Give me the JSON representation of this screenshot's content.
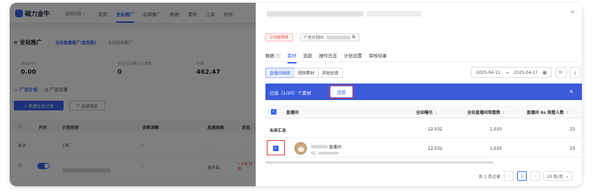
{
  "topnav": {
    "logo": "磁力金牛",
    "back": "返回旧版 ›",
    "items": [
      "首页",
      "全站推广",
      "品牌推广",
      "数据",
      "素材",
      "工具",
      "财务"
    ]
  },
  "campaign_panel": {
    "title": "全站推广",
    "tab_live": "全站直播推广(智投版)",
    "tab_goods": "全站商品推广",
    "metrics": [
      {
        "label": "全站ROI",
        "value": "0.00"
      },
      {
        "label": "全站当日累计订单数",
        "value": "0"
      },
      {
        "label": "花费",
        "value": "462.47"
      }
    ]
  },
  "plan_panel": {
    "tab_plan": "广告计划",
    "tab_creative": "广告创意",
    "new_button": "+ 新建全站计划",
    "filter_button": "全部筛选",
    "columns": [
      "开关",
      "计划名称",
      "诊断洞察",
      "加速探索",
      "状态"
    ],
    "total_row": {
      "label": "总计",
      "count": "1项",
      "dash1": "-",
      "dash2": "-",
      "dash3": "-"
    },
    "row": {
      "dash": "-",
      "status": "未开启",
      "note": "• 计划 原因"
    }
  },
  "drawer": {
    "close": "×",
    "tag_budget": "计划超预算",
    "tag_plan_id": "广告计划ID:",
    "tabs": [
      "数据",
      "素材",
      "追投",
      "操作日志",
      "计划设置",
      "审核结果"
    ],
    "active_tab": "素材",
    "segments": [
      "直播间画面",
      "视频素材",
      "其他创意"
    ],
    "date_start": "2025-04-11",
    "date_sep": "→",
    "date_end": "2025-04-17",
    "selection_text": "已选（1/20）个素材",
    "push_button": "追投",
    "selection_close": "×",
    "table": {
      "col_room": "直播间",
      "col_exposure": "全站曝光",
      "col_views": "全站直播间观看数",
      "col_6s": "直播间 6s 观看人数",
      "summary_label": "未来汇总",
      "summary": {
        "exposure": "12,532",
        "views": "1,010",
        "six_s": "23"
      },
      "row": {
        "name_suffix": "直播间",
        "id_prefix": "ID:",
        "exposure": "12,532",
        "views": "1,010",
        "six_s": "23"
      }
    },
    "pager": {
      "total": "共 1 条记录",
      "prev": "‹",
      "page": "1",
      "next": "›",
      "size": "10 条/页"
    }
  }
}
